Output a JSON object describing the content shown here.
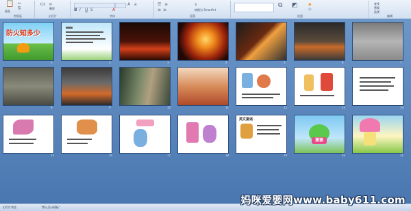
{
  "ribbon": {
    "groups": [
      {
        "label": "剪贴板"
      },
      {
        "label": "幻灯片"
      },
      {
        "label": "字体"
      },
      {
        "label": "段落"
      },
      {
        "label": "绘图"
      },
      {
        "label": "编辑"
      }
    ],
    "paste_label": "粘贴",
    "new_slide_label": "新建幻灯片",
    "delete_label": "删除",
    "find_label": "查找",
    "replace_label": "替换",
    "select_label": "选择",
    "convert_smartart_label": "转换为 SmartArt"
  },
  "slides": [
    {
      "num": "1",
      "title": "防火知多少",
      "kind": "title"
    },
    {
      "num": "2",
      "kind": "text"
    },
    {
      "num": "3",
      "kind": "fire-night"
    },
    {
      "num": "4",
      "kind": "fire-tree"
    },
    {
      "num": "5",
      "kind": "fire-building"
    },
    {
      "num": "6",
      "kind": "fire-street"
    },
    {
      "num": "7",
      "kind": "smoke-building"
    },
    {
      "num": "8",
      "kind": "ruin"
    },
    {
      "num": "9",
      "kind": "fire-truck"
    },
    {
      "num": "10",
      "kind": "forest-fire"
    },
    {
      "num": "11",
      "kind": "firefighter"
    },
    {
      "num": "12",
      "kind": "cartoon"
    },
    {
      "num": "13",
      "kind": "cartoon"
    },
    {
      "num": "14",
      "kind": "cartoon-text"
    },
    {
      "num": "15",
      "kind": "cartoon"
    },
    {
      "num": "16",
      "kind": "cartoon"
    },
    {
      "num": "17",
      "kind": "cartoon"
    },
    {
      "num": "18",
      "kind": "cartoon"
    },
    {
      "num": "19",
      "title": "英文童谣",
      "kind": "cartoon-title"
    },
    {
      "num": "20",
      "title": "谢谢",
      "kind": "thanks"
    },
    {
      "num": "21",
      "kind": "house"
    }
  ],
  "status": {
    "left": "幻灯片浏览",
    "center": "\"默认设计模板\""
  },
  "watermark": "妈咪爱婴网www.baby611.com"
}
